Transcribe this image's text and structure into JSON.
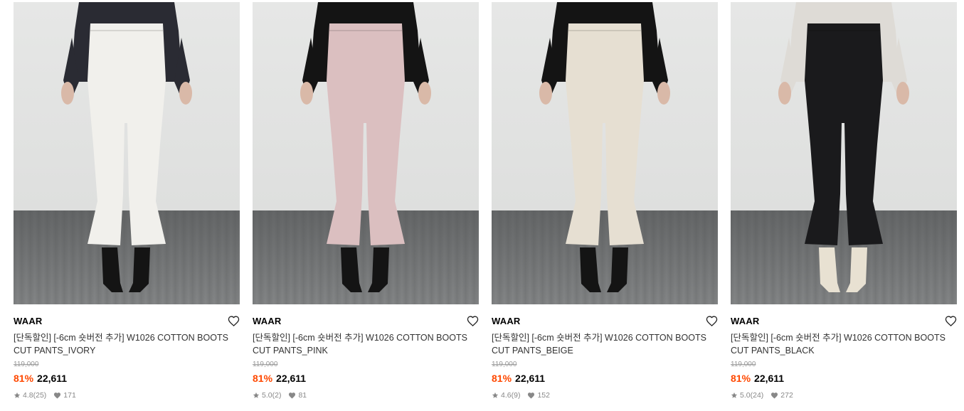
{
  "products": [
    {
      "brand": "WAAR",
      "name": "[단독할인] [-6cm 숏버전 추가] W1026 COTTON BOOTS CUT PANTS_IVORY",
      "original_price": "119,000",
      "discount": "81%",
      "price": "22,611",
      "rating": "4.8",
      "reviews": "(25)",
      "likes": "171",
      "pants_color": "#f1f0ec",
      "top_color": "#2a2b33",
      "shoe_color": "#141414"
    },
    {
      "brand": "WAAR",
      "name": "[단독할인] [-6cm 숏버전 추가] W1026 COTTON BOOTS CUT PANTS_PINK",
      "original_price": "119,000",
      "discount": "81%",
      "price": "22,611",
      "rating": "5.0",
      "reviews": "(2)",
      "likes": "81",
      "pants_color": "#dbbfc0",
      "top_color": "#141414",
      "shoe_color": "#141414"
    },
    {
      "brand": "WAAR",
      "name": "[단독할인] [-6cm 숏버전 추가] W1026 COTTON BOOTS CUT PANTS_BEIGE",
      "original_price": "119,000",
      "discount": "81%",
      "price": "22,611",
      "rating": "4.6",
      "reviews": "(9)",
      "likes": "152",
      "pants_color": "#e6dfd2",
      "top_color": "#141414",
      "shoe_color": "#141414"
    },
    {
      "brand": "WAAR",
      "name": "[단독할인] [-6cm 숏버전 추가] W1026 COTTON BOOTS CUT PANTS_BLACK",
      "original_price": "119,000",
      "discount": "81%",
      "price": "22,611",
      "rating": "5.0",
      "reviews": "(24)",
      "likes": "272",
      "pants_color": "#1a1a1c",
      "top_color": "#dedbd6",
      "shoe_color": "#e8e1d2"
    }
  ],
  "colors": {
    "discount": "#ff4800",
    "muted": "#888888"
  },
  "icons": {
    "wishlist": "heart-outline-icon",
    "rating": "star-icon",
    "likes": "heart-filled-icon"
  }
}
